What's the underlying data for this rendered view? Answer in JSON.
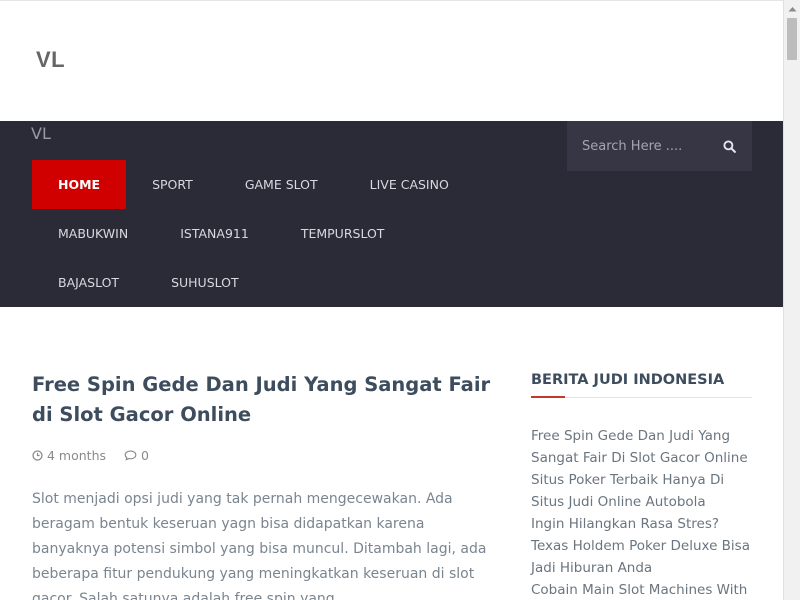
{
  "header": {
    "logo": "VL"
  },
  "nav": {
    "tagline": "VL",
    "search_placeholder": "Search Here ....",
    "menu_row1": [
      "HOME",
      "SPORT",
      "GAME SLOT",
      "LIVE CASINO"
    ],
    "menu_row2": [
      "MABUKWIN",
      "ISTANA911",
      "TEMPURSLOT"
    ],
    "menu_row3": [
      "BAJASLOT",
      "SUHUSLOT"
    ],
    "active_item": "HOME"
  },
  "post": {
    "title": "Free Spin Gede Dan Judi Yang Sangat Fair di Slot Gacor Online",
    "date": "4 months",
    "comments": "0",
    "excerpt": "Slot menjadi opsi judi yang tak pernah mengecewakan. Ada beragam bentuk keseruan yagn bisa didapatkan karena banyaknya potensi simbol yang bisa muncul. Ditambah lagi, ada beberapa fitur pendukung yang meningkatkan keseruan di slot gacor. Salah satunya adalah free spin yang"
  },
  "sidebar": {
    "widget_title": "BERITA JUDI INDONESIA",
    "links": [
      "Free Spin Gede Dan Judi Yang Sangat Fair Di Slot Gacor Online",
      "Situs Poker Terbaik Hanya Di Situs Judi Online Autobola",
      "Ingin Hilangkan Rasa Stres? Texas Holdem Poker Deluxe Bisa Jadi Hiburan Anda",
      "Cobain Main Slot Machines With"
    ]
  },
  "colors": {
    "nav_bg": "#2b2b38",
    "active_bg": "#d10000",
    "title": "#3d4d5e",
    "accent": "#c0392b"
  },
  "icons": {
    "search": "search-icon",
    "clock": "clock-icon",
    "comment": "comment-icon"
  }
}
